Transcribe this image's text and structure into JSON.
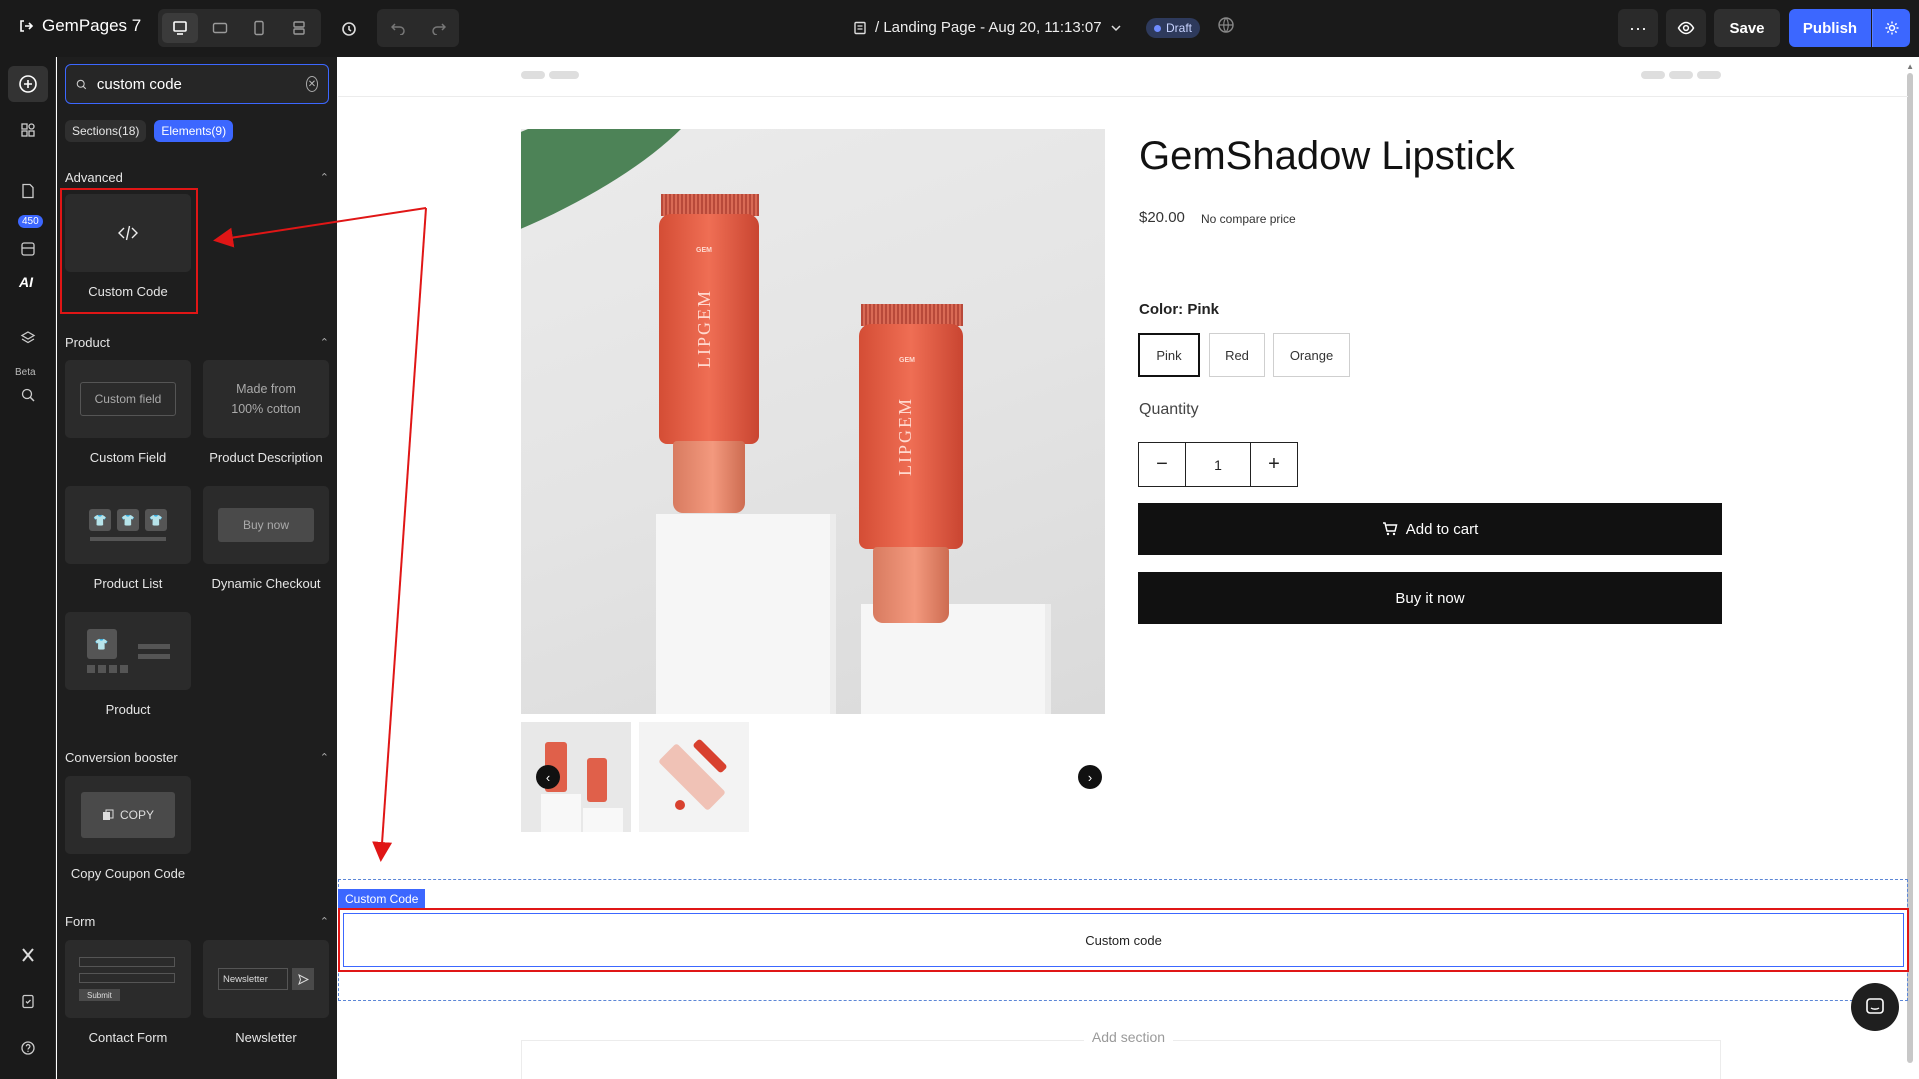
{
  "topbar": {
    "app_name": "GemPages 7",
    "page_title": "/ Landing Page - Aug 20, 11:13:07",
    "status_badge": "Draft",
    "save_label": "Save",
    "publish_label": "Publish",
    "more_label": "···"
  },
  "rail": {
    "badge_count": "450",
    "ai_label": "AI",
    "beta_label": "Beta"
  },
  "panel": {
    "search": {
      "value": "custom code"
    },
    "tabs": [
      {
        "label": "Sections(18)"
      },
      {
        "label": "Elements(9)"
      }
    ],
    "categories": {
      "advanced": "Advanced",
      "product": "Product",
      "conversion": "Conversion booster",
      "form": "Form"
    },
    "elements": {
      "custom_code": "Custom Code",
      "custom_field": "Custom Field",
      "custom_field_thumb": "Custom field",
      "product_description": "Product Description",
      "product_description_thumb": "Made from 100% cotton",
      "product_list": "Product List",
      "dynamic_checkout": "Dynamic Checkout",
      "dynamic_checkout_thumb": "Buy now",
      "product": "Product",
      "copy_coupon": "Copy Coupon Code",
      "copy_thumb": "COPY",
      "contact_form": "Contact Form",
      "contact_thumb": "Submit",
      "newsletter": "Newsletter",
      "newsletter_thumb": "Newsletter"
    }
  },
  "canvas": {
    "product_title": "GemShadow Lipstick",
    "price": "$20.00",
    "compare_price": "No compare price",
    "color_label_prefix": "Color:",
    "color_selected": "Pink",
    "color_options": [
      "Pink",
      "Red",
      "Orange"
    ],
    "quantity_label": "Quantity",
    "quantity_value": "1",
    "add_to_cart": "Add to cart",
    "buy_now": "Buy it now",
    "tube_brand": "LIPGEM",
    "tube_logo": "GEM",
    "custom_code_tag": "Custom Code",
    "custom_code_text": "Custom code",
    "add_section": "Add section"
  },
  "colors": {
    "accent": "#3c67ff",
    "highlight": "#e01616",
    "topbar_bg": "#1a1a1a",
    "panel_bg": "#1e1e1e"
  }
}
